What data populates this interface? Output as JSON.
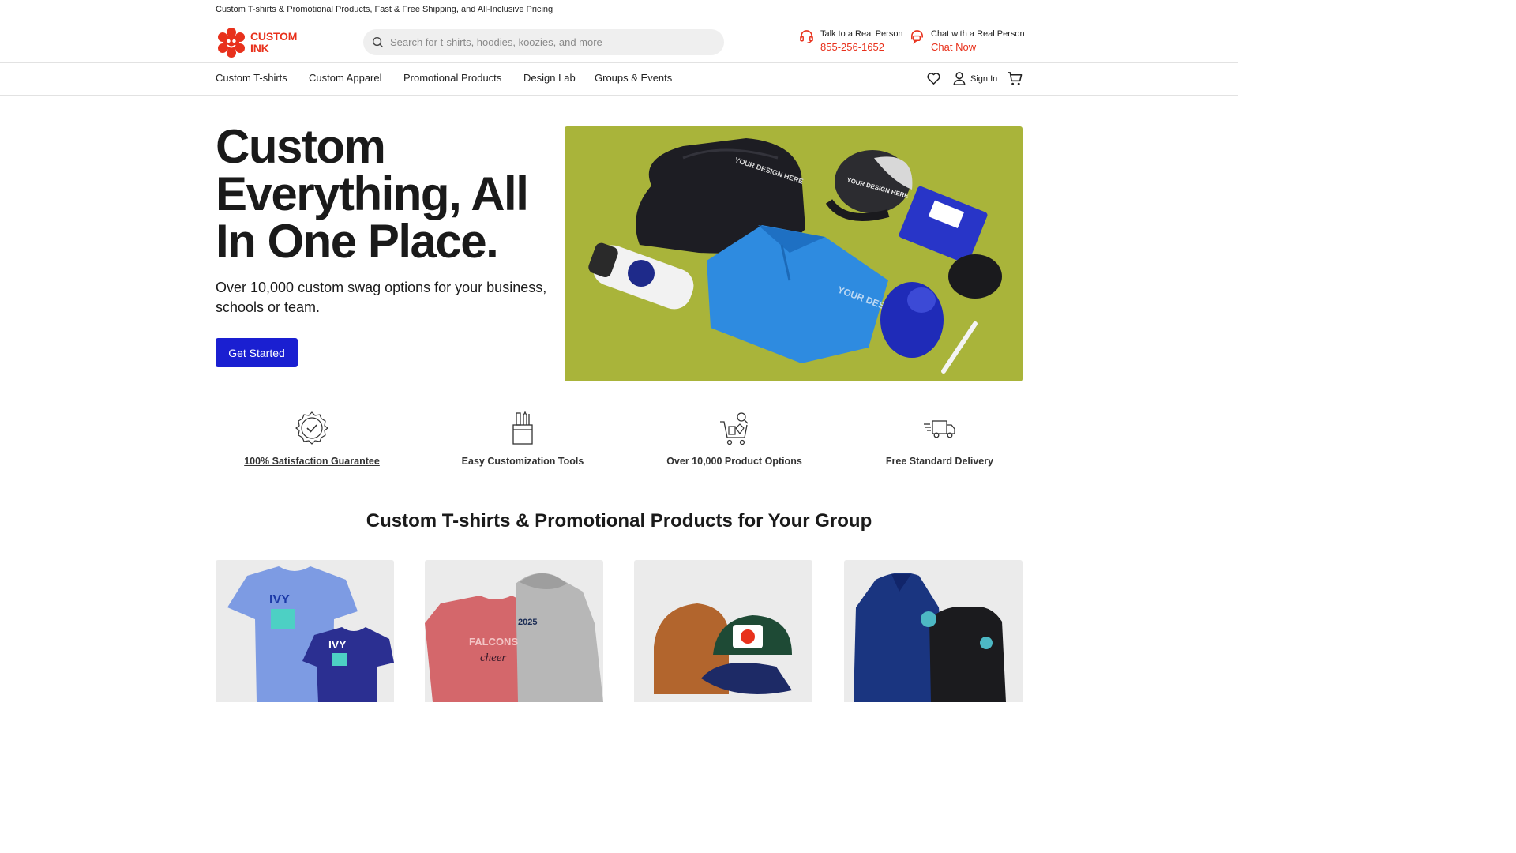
{
  "promo": {
    "text": "Custom T-shirts & Promotional Products, Fast & Free Shipping, and All-Inclusive Pricing"
  },
  "header": {
    "logo_line1": "CUSTOM",
    "logo_line2": "INK",
    "search_placeholder": "Search for t-shirts, hoodies, koozies, and more",
    "phone": {
      "label": "Talk to a Real Person",
      "value": "855-256-1652"
    },
    "chat": {
      "label": "Chat with a Real Person",
      "value": "Chat Now"
    }
  },
  "nav": {
    "items": [
      "Custom T-shirts",
      "Custom Apparel",
      "Promotional Products",
      "Design Lab",
      "Groups & Events"
    ],
    "sign_in": "Sign In"
  },
  "hero": {
    "title": "Custom Everything, All In One Place.",
    "subtitle": "Over 10,000 custom swag options for your business, schools or team.",
    "cta": "Get Started",
    "image_text": "YOUR DESIGN HERE"
  },
  "features": [
    {
      "label": "100% Satisfaction Guarantee",
      "icon": "badge-check-icon"
    },
    {
      "label": "Easy Customization Tools",
      "icon": "design-tools-icon"
    },
    {
      "label": "Over 10,000 Product Options",
      "icon": "product-cart-icon"
    },
    {
      "label": "Free Standard Delivery",
      "icon": "delivery-truck-icon"
    }
  ],
  "section": {
    "title": "Custom T-shirts & Promotional Products for Your Group"
  },
  "cards": {
    "tshirt_text": "IVY",
    "sweat_text": "FALCONS",
    "sweat_script": "cheer",
    "hoodie_year": "2025"
  },
  "colors": {
    "brand_red": "#e8311c",
    "cta_blue": "#1a1fd1",
    "hero_bg": "#a9b43a"
  }
}
